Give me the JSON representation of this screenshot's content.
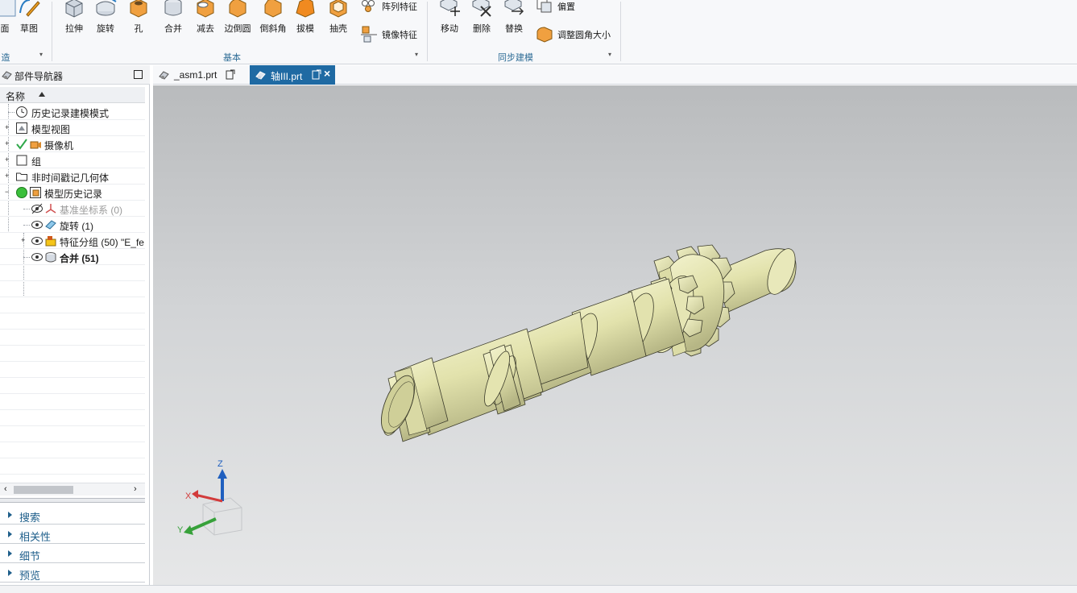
{
  "ribbon": {
    "left_partial": {
      "face_label": "面",
      "sketch_label": "草图",
      "group_title_partial": "造"
    },
    "basic_group": {
      "title": "基本",
      "tools": [
        {
          "name": "extrude",
          "label": "拉伸"
        },
        {
          "name": "revolve",
          "label": "旋转"
        },
        {
          "name": "hole",
          "label": "孔"
        },
        {
          "name": "unite",
          "label": "合并"
        },
        {
          "name": "subtract",
          "label": "减去"
        },
        {
          "name": "edge-blend",
          "label": "边倒圆"
        },
        {
          "name": "chamfer",
          "label": "倒斜角"
        },
        {
          "name": "draft",
          "label": "拔模"
        },
        {
          "name": "shell",
          "label": "抽壳"
        }
      ],
      "pattern_label": "阵列特征",
      "mirror_label": "镜像特征"
    },
    "sync_group": {
      "title": "同步建模",
      "tools": [
        {
          "name": "move",
          "label": "移动"
        },
        {
          "name": "delete",
          "label": "删除"
        },
        {
          "name": "replace",
          "label": "替换"
        }
      ],
      "offset_label": "偏置",
      "resize_blend_label": "调整圆角大小"
    }
  },
  "navigator": {
    "title": "部件导航器",
    "column_header": "名称",
    "tree": [
      {
        "label": "历史记录建模模式",
        "icon": "clock-icon"
      },
      {
        "label": "模型视图",
        "icon": "model-view-icon"
      },
      {
        "label": "摄像机",
        "icon": "camera-icon"
      },
      {
        "label": "组",
        "icon": "group-icon"
      },
      {
        "label": "非时间戳记几何体",
        "icon": "folder-icon"
      },
      {
        "label": "模型历史记录",
        "icon": "model-history-icon"
      },
      {
        "label": "基准坐标系 (0)",
        "icon": "datum-csys-icon"
      },
      {
        "label": "旋转 (1)",
        "icon": "revolve-feature-icon"
      },
      {
        "label": "特征分组 (50) \"E_fe",
        "icon": "feature-group-icon"
      },
      {
        "label": "合并 (51)",
        "icon": "unite-feature-icon"
      }
    ],
    "panels": [
      "搜索",
      "相关性",
      "细节",
      "预览"
    ]
  },
  "tabs": [
    {
      "label": "_asm1.prt",
      "active": false
    },
    {
      "label": "轴III.prt",
      "active": true
    }
  ],
  "triad": {
    "x": "X",
    "y": "Y",
    "z": "Z"
  },
  "colors": {
    "accent": "#1f6aa3",
    "model": "#e6e6b2",
    "model_shadow": "#b9b98a",
    "edge": "#3a3a2a",
    "axis_x": "#d23b3b",
    "axis_y": "#37a13a",
    "axis_z": "#1f5fbf"
  }
}
